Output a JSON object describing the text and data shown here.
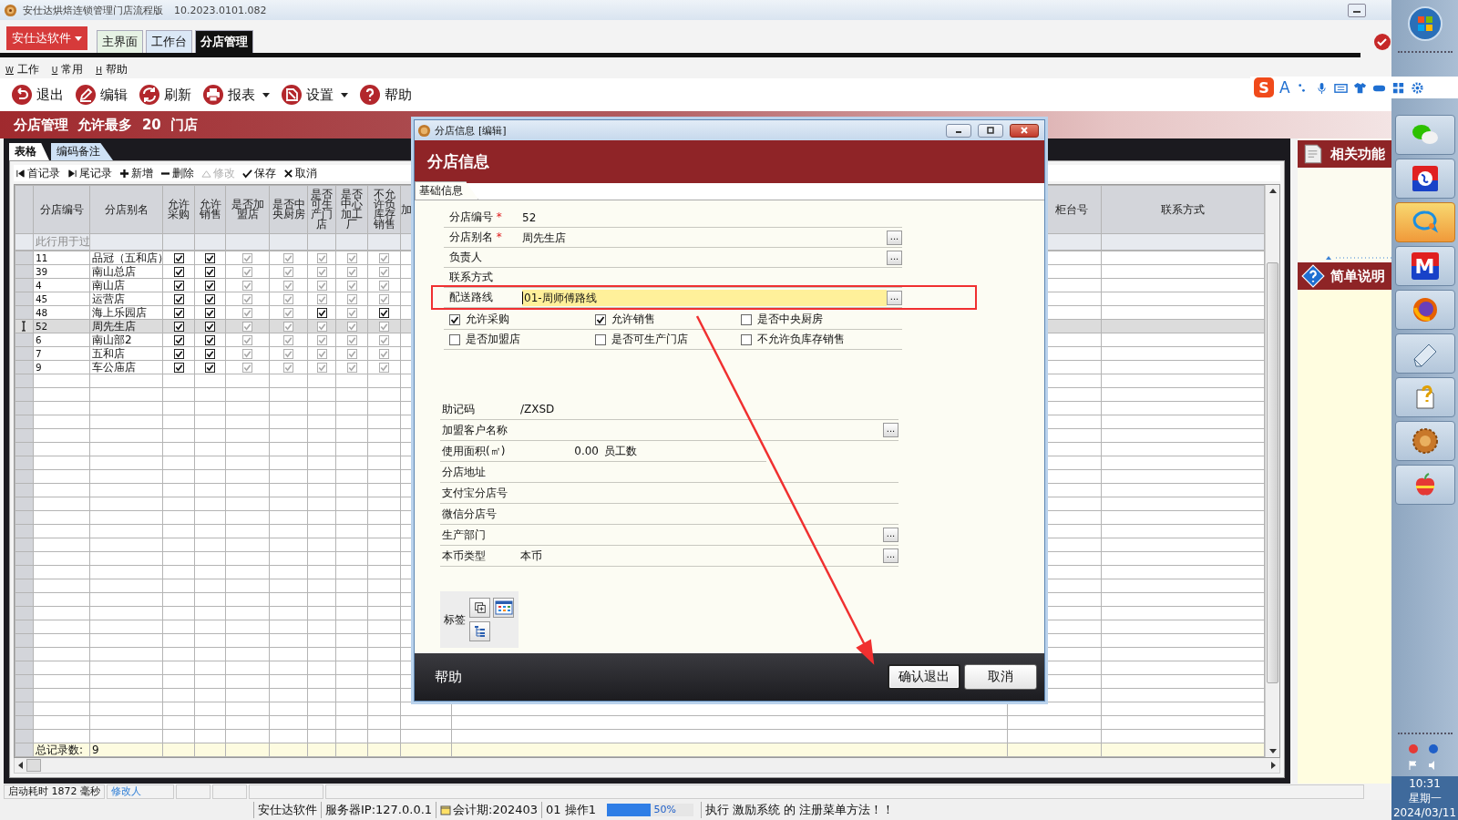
{
  "window": {
    "title": "安仕达烘焙连锁管理门店流程版",
    "version": "10.2023.0101.082"
  },
  "app_button": "安仕达软件",
  "tabs": [
    {
      "label": "主界面",
      "selected": false
    },
    {
      "label": "工作台",
      "selected": false
    },
    {
      "label": "分店管理",
      "selected": true
    }
  ],
  "menu": [
    {
      "key": "W",
      "label": "工作"
    },
    {
      "key": "U",
      "label": "常用"
    },
    {
      "key": "H",
      "label": "帮助"
    }
  ],
  "toolbar": [
    {
      "label": "退出",
      "kind": "back",
      "dropdown": false
    },
    {
      "label": "编辑",
      "kind": "edit",
      "dropdown": false
    },
    {
      "label": "刷新",
      "kind": "refresh",
      "dropdown": false
    },
    {
      "label": "报表",
      "kind": "print",
      "dropdown": true
    },
    {
      "label": "设置",
      "kind": "settings",
      "dropdown": true
    },
    {
      "label": "帮助",
      "kind": "help",
      "dropdown": false
    }
  ],
  "ime_bar": {
    "logo": "S",
    "mode": "A"
  },
  "header": "分店管理  允许最多  20  门店",
  "subtabs": [
    {
      "label": "表格",
      "selected": true
    },
    {
      "label": "编码备注",
      "selected": false
    }
  ],
  "grid_toolbar": [
    {
      "label": "首记录",
      "kind": "first",
      "disabled": false
    },
    {
      "label": "尾记录",
      "kind": "last",
      "disabled": false
    },
    {
      "label": "新增",
      "kind": "add",
      "disabled": false
    },
    {
      "label": "删除",
      "kind": "delete",
      "disabled": false
    },
    {
      "label": "修改",
      "kind": "modify",
      "disabled": true
    },
    {
      "label": "保存",
      "kind": "save",
      "disabled": false
    },
    {
      "label": "取消",
      "kind": "cancel",
      "disabled": false
    }
  ],
  "grid": {
    "columns": [
      {
        "label": "分店编号",
        "kind": "text"
      },
      {
        "label": "分店别名",
        "kind": "text"
      },
      {
        "label": "允许采购",
        "kind": "flag"
      },
      {
        "label": "允许销售",
        "kind": "flag"
      },
      {
        "label": "是否加盟店",
        "kind": "flag"
      },
      {
        "label": "是否中央厨房",
        "kind": "flag"
      },
      {
        "label": "是否可生产门店",
        "kind": "flag"
      },
      {
        "label": "是否中心加工厂",
        "kind": "flag"
      },
      {
        "label": "不允许负库存销售",
        "kind": "flag"
      },
      {
        "label": "加",
        "kind": "cut"
      },
      {
        "label": "柜台号",
        "kind": "cut_right"
      },
      {
        "label": "联系方式",
        "kind": "text"
      }
    ],
    "filter_hint": "此行用于过",
    "rows": [
      {
        "code": "11",
        "name": "品冠（五和店）",
        "flags": [
          true,
          true,
          false,
          false,
          false,
          false,
          false
        ],
        "selected": false
      },
      {
        "code": "39",
        "name": "南山总店",
        "flags": [
          true,
          true,
          false,
          false,
          false,
          false,
          false
        ],
        "selected": false
      },
      {
        "code": "4",
        "name": "南山店",
        "flags": [
          true,
          true,
          false,
          false,
          false,
          false,
          false
        ],
        "selected": false
      },
      {
        "code": "45",
        "name": "运营店",
        "flags": [
          true,
          true,
          false,
          false,
          false,
          false,
          false
        ],
        "selected": false
      },
      {
        "code": "48",
        "name": "海上乐园店",
        "flags": [
          true,
          true,
          false,
          false,
          true,
          false,
          true
        ],
        "selected": false
      },
      {
        "code": "52",
        "name": "周先生店",
        "flags": [
          true,
          true,
          false,
          false,
          false,
          false,
          false
        ],
        "selected": true
      },
      {
        "code": "6",
        "name": "南山部2",
        "flags": [
          true,
          true,
          false,
          false,
          false,
          false,
          false
        ],
        "selected": false
      },
      {
        "code": "7",
        "name": "五和店",
        "flags": [
          true,
          true,
          false,
          false,
          false,
          false,
          false
        ],
        "selected": false
      },
      {
        "code": "9",
        "name": "车公庙店",
        "flags": [
          true,
          true,
          false,
          false,
          false,
          false,
          false
        ],
        "selected": false
      }
    ],
    "total_label": "总记录数:",
    "total": "9"
  },
  "side_panels": [
    {
      "title": "相关功能",
      "kind": "document"
    },
    {
      "title": "简单说明",
      "kind": "help"
    }
  ],
  "status_bar": {
    "startup": "启动耗时 1872 毫秒",
    "modifier": "修改人"
  },
  "footer": {
    "company": "安仕达软件",
    "server": "服务器IP:127.0.0.1",
    "period": "会计期:202403",
    "operator": "01 操作1",
    "progress": {
      "level": 0.5,
      "label": "50%"
    },
    "message": "执行 激励系统 的 注册菜单方法！！"
  },
  "dock": {
    "apps": [
      {
        "kind": "wechat",
        "selected": false
      },
      {
        "kind": "globe",
        "selected": false
      },
      {
        "kind": "chat",
        "selected": true
      },
      {
        "kind": "metro",
        "text": "M",
        "selected": false
      },
      {
        "kind": "firefox",
        "selected": false
      },
      {
        "kind": "eraser",
        "selected": false
      },
      {
        "kind": "helpdoc",
        "selected": false
      },
      {
        "kind": "cookie",
        "selected": false
      },
      {
        "kind": "apple",
        "selected": false
      }
    ],
    "time": "10:31",
    "weekday": "星期一",
    "date": "2024/03/11"
  },
  "dialog": {
    "title": "分店信息",
    "mode": "[编辑]",
    "heading": "分店信息",
    "tab": "基础信息",
    "required_mark": "*",
    "lookup_glyph": "...",
    "fields": [
      {
        "label": "分店编号",
        "required": true,
        "value": "52",
        "lookup": false,
        "highlighted": false
      },
      {
        "label": "分店别名",
        "required": true,
        "value": "周先生店",
        "lookup": true,
        "highlighted": false
      },
      {
        "label": "负责人",
        "required": false,
        "lookup": true,
        "highlighted": false
      },
      {
        "label": "联系方式",
        "required": false,
        "lookup": false,
        "highlighted": false
      },
      {
        "label": "配送路线",
        "required": false,
        "value": "01-周师傅路线",
        "lookup": true,
        "highlighted": true
      }
    ],
    "options": [
      {
        "label": "允许采购",
        "checked": true
      },
      {
        "label": "允许销售",
        "checked": true
      },
      {
        "label": "是否中央厨房",
        "checked": false
      },
      {
        "label": "是否加盟店",
        "checked": false
      },
      {
        "label": "是否可生产门店",
        "checked": false
      },
      {
        "label": "不允许负库存销售",
        "checked": false
      }
    ],
    "fields2": [
      {
        "label": "助记码",
        "kind": "text",
        "value": "/ZXSD",
        "lookup": false
      },
      {
        "label": "加盟客户名称",
        "kind": "text",
        "lookup": true
      },
      {
        "label": "使用面积(㎡)",
        "kind": "number",
        "value": "0.00",
        "extra_label": "员工数",
        "lookup": false
      },
      {
        "label": "分店地址",
        "kind": "text",
        "lookup": false
      },
      {
        "label": "支付宝分店号",
        "kind": "text",
        "lookup": false
      },
      {
        "label": "微信分店号",
        "kind": "text",
        "lookup": false
      },
      {
        "label": "生产部门",
        "kind": "text",
        "lookup": true
      },
      {
        "label": "本币类型",
        "kind": "text",
        "value": "本币",
        "lookup": true
      }
    ],
    "tag_label": "标签",
    "help": "帮助",
    "buttons": [
      {
        "label": "确认退出",
        "kind": "primary"
      },
      {
        "label": "取消",
        "kind": "cancel"
      }
    ]
  }
}
